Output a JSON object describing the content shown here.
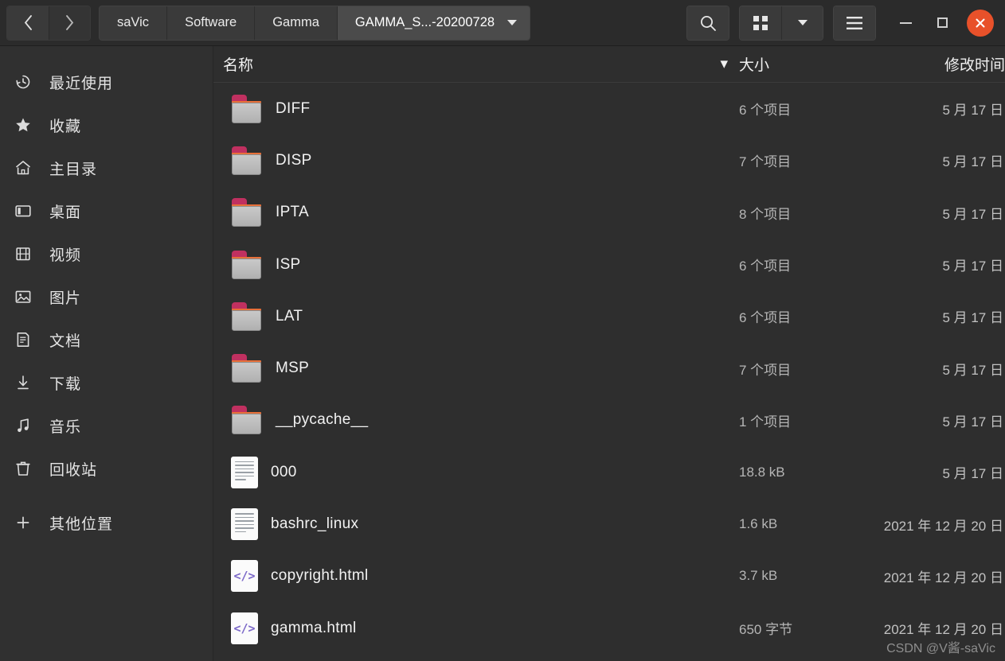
{
  "window": {
    "nav": {
      "back_label": "‹",
      "forward_label": "›"
    },
    "breadcrumbs": [
      {
        "label": "saVic",
        "current": false
      },
      {
        "label": "Software",
        "current": false
      },
      {
        "label": "Gamma",
        "current": false
      },
      {
        "label": "GAMMA_S...-20200728",
        "current": true
      }
    ],
    "toolbar": {
      "search_label": "search-icon",
      "grid_view_label": "grid-view-icon",
      "view_dropdown_label": "chevron-down-icon",
      "menu_label": "hamburger-menu-icon"
    },
    "controls": {
      "minimize_label": "minimize",
      "maximize_label": "maximize",
      "close_label": "✕"
    },
    "accent_close_color": "#e8512a"
  },
  "sidebar": {
    "items": [
      {
        "label": "最近使用",
        "icon": "clock-icon"
      },
      {
        "label": "收藏",
        "icon": "star-icon"
      },
      {
        "label": "主目录",
        "icon": "home-icon"
      },
      {
        "label": "桌面",
        "icon": "desktop-icon"
      },
      {
        "label": "视频",
        "icon": "video-icon"
      },
      {
        "label": "图片",
        "icon": "picture-icon"
      },
      {
        "label": "文档",
        "icon": "document-icon"
      },
      {
        "label": "下载",
        "icon": "download-icon"
      },
      {
        "label": "音乐",
        "icon": "music-icon"
      },
      {
        "label": "回收站",
        "icon": "trash-icon"
      }
    ],
    "other_locations": {
      "label": "其他位置",
      "icon": "plus-icon"
    }
  },
  "file_list": {
    "columns": {
      "name": "名称",
      "size": "大小",
      "modified": "修改时间"
    },
    "sort_indicator": "▾",
    "rows": [
      {
        "name": "DIFF",
        "type": "folder",
        "size": "6 个项目",
        "modified": "5 月 17 日"
      },
      {
        "name": "DISP",
        "type": "folder",
        "size": "7 个项目",
        "modified": "5 月 17 日"
      },
      {
        "name": "IPTA",
        "type": "folder",
        "size": "8 个项目",
        "modified": "5 月 17 日"
      },
      {
        "name": "ISP",
        "type": "folder",
        "size": "6 个项目",
        "modified": "5 月 17 日"
      },
      {
        "name": "LAT",
        "type": "folder",
        "size": "6 个项目",
        "modified": "5 月 17 日"
      },
      {
        "name": "MSP",
        "type": "folder",
        "size": "7 个项目",
        "modified": "5 月 17 日"
      },
      {
        "name": "__pycache__",
        "type": "folder",
        "size": "1 个项目",
        "modified": "5 月 17 日"
      },
      {
        "name": "000",
        "type": "text",
        "size": "18.8 kB",
        "modified": "5 月 17 日"
      },
      {
        "name": "bashrc_linux",
        "type": "text",
        "size": "1.6 kB",
        "modified": "2021 年 12 月 20 日"
      },
      {
        "name": "copyright.html",
        "type": "html",
        "size": "3.7 kB",
        "modified": "2021 年 12 月 20 日"
      },
      {
        "name": "gamma.html",
        "type": "html",
        "size": "650 字节",
        "modified": "2021 年 12 月 20 日"
      }
    ]
  },
  "watermark": {
    "text": "CSDN @V酱-saVic"
  }
}
